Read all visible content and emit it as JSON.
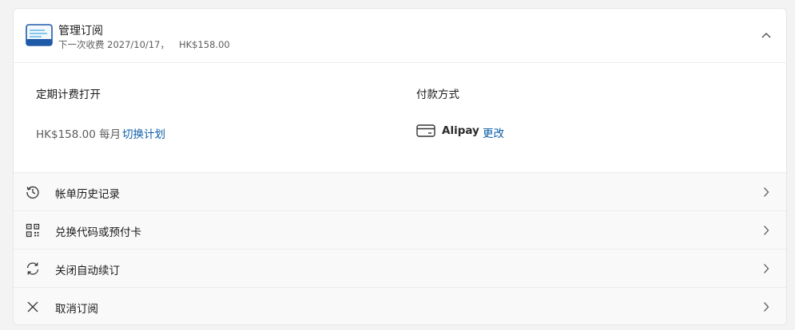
{
  "colors": {
    "accent": "#0b5ea8",
    "icon_blue": "#1e5aa8",
    "icon_cyan": "#5fb7e8"
  },
  "header": {
    "icon": "subscription-card-icon",
    "title": "管理订阅",
    "next_billing_label": "下一次收费",
    "next_billing_date": "2027/10/17，",
    "next_billing_amount": "HK$158.00",
    "collapse_icon": "chevron-up-icon"
  },
  "billing": {
    "label": "定期计费打开",
    "price": "HK$158.00 每月",
    "switch_plan_link": "切换计划"
  },
  "payment": {
    "label": "付款方式",
    "method_icon": "credit-card-icon",
    "method": "Alipay",
    "change_link": "更改"
  },
  "rows": [
    {
      "icon": "history-icon",
      "label": "帐单历史记录"
    },
    {
      "icon": "qr-code-icon",
      "label": "兑换代码或预付卡"
    },
    {
      "icon": "sync-icon",
      "label": "关闭自动续订"
    },
    {
      "icon": "close-icon",
      "label": "取消订阅"
    }
  ]
}
